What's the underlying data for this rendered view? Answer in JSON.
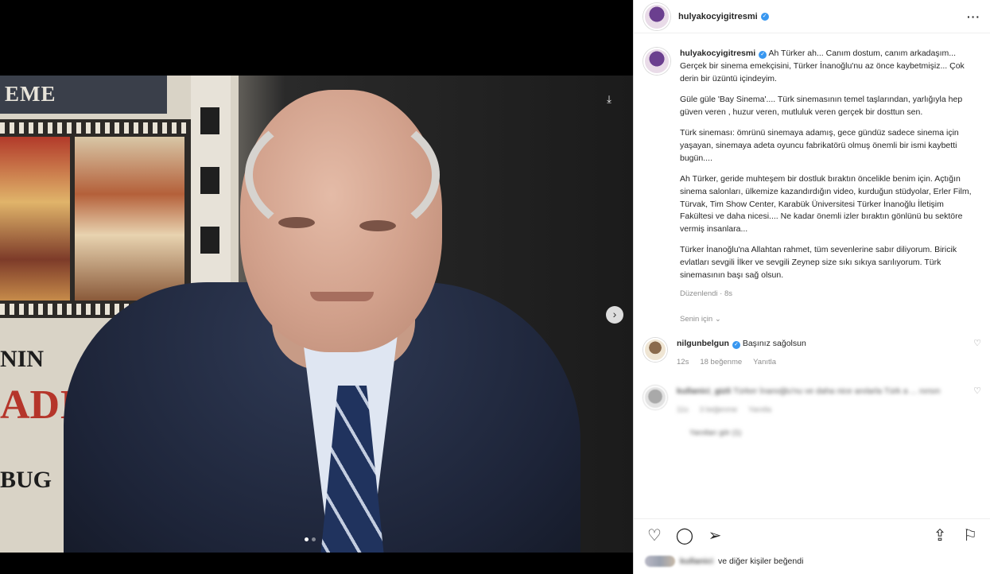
{
  "post": {
    "username": "hulyakocyigitresmi",
    "more_icon": "more-icon"
  },
  "media": {
    "banner_text": "EME",
    "bill_lines": [
      "NIN",
      "ADIT",
      "BUG"
    ],
    "slide_count": 2,
    "active_slide": 1
  },
  "caption": {
    "username": "hulyakocyigitresmi",
    "paragraphs": [
      "Ah Türker ah... Canım dostum, canım arkadaşım... Gerçek bir sinema emekçisini, Türker İnanoğlu'nu az önce kaybetmişiz... Çok derin bir üzüntü içindeyim.",
      "Güle güle 'Bay Sinema'.... Türk sinemasının temel taşlarından, yarlığıyla hep güven veren , huzur veren, mutluluk veren gerçek bir dosttun sen.",
      "Türk sineması: ömrünü sinemaya adamış, gece gündüz sadece sinema için yaşayan, sinemaya adeta oyuncu fabrikatörü olmuş önemli bir ismi kaybetti bugün....",
      "Ah Türker, geride muhteşem bir dostluk bıraktın öncelikle benim için. Açtığın sinema salonları, ülkemize kazandırdığın video, kurduğun stüdyolar, Erler Film, Türvak, Tim Show Center, Karabük Üniversitesi Türker İnanoğlu İletişim Fakültesi ve daha nicesi.... Ne kadar önemli izler bıraktın gönlünü bu sektöre vermiş insanlara...",
      "Türker İnanoğlu'na Allahtan rahmet, tüm sevenlerine sabır diliyorum. Biricik evlatları sevgili İlker ve sevgili Zeynep size sıkı sıkıya sarılıyorum. Türk sinemasının başı sağ olsun."
    ],
    "edited": "Düzenlendi · 8s",
    "translate": "Senin için"
  },
  "comments": [
    {
      "username": "nilgunbelgun",
      "text": "Başınız sağolsun",
      "time": "12s",
      "likes": "18 beğenme",
      "reply": "Yanıtla"
    },
    {
      "username": "kullanici_gizli",
      "text": "Türker İnanoğlu'nu ve daha nice anılarla Türk a ... nırsın",
      "time": "11s",
      "likes": "3 beğenme",
      "reply": "Yanıtla"
    }
  ],
  "view_replies": "Yanıtları gör (1)",
  "footer": {
    "liked_by_name": "kullanici",
    "liked_by_suffix": "ve diğer kişiler beğendi"
  },
  "colors": {
    "verified": "#3897f0",
    "text": "#262626",
    "muted": "#8e8e8e"
  }
}
